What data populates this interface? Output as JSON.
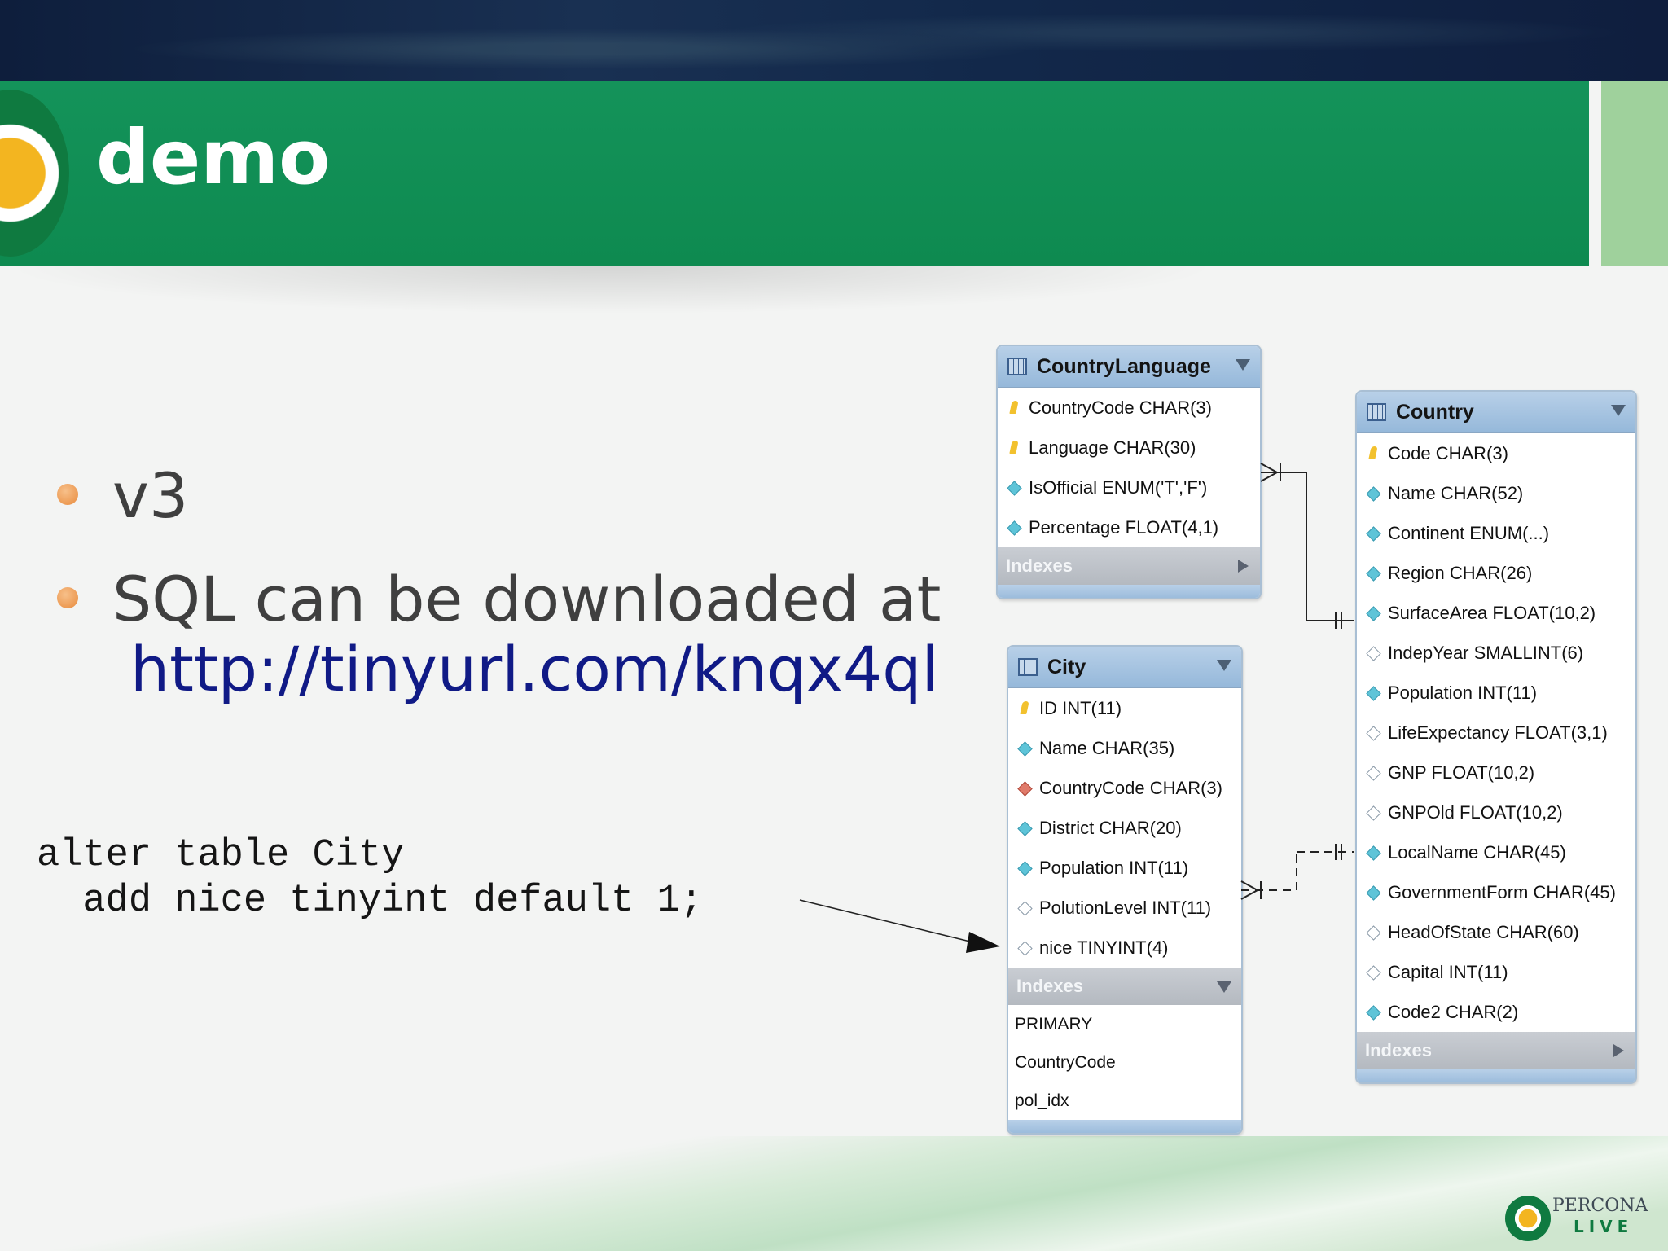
{
  "slide": {
    "title": "demo",
    "bullets": [
      "v3",
      "SQL can be downloaded at"
    ],
    "link": "http://tinyurl.com/knqx4ql",
    "code_lines": [
      "alter table City",
      "  add nice tinyint default 1;"
    ]
  },
  "brand": {
    "name": "PERCONA",
    "sub": "LIVE",
    "green": "#0e8a50",
    "accent": "#f3b520",
    "link_color": "#101a86"
  },
  "tables": {
    "countrylanguage": {
      "name": "CountryLanguage",
      "columns": [
        {
          "label": "CountryCode CHAR(3)",
          "icon": "primary-key-icon"
        },
        {
          "label": "Language CHAR(30)",
          "icon": "primary-key-icon"
        },
        {
          "label": "IsOfficial ENUM('T','F')",
          "icon": "column-icon"
        },
        {
          "label": "Percentage FLOAT(4,1)",
          "icon": "column-icon"
        }
      ],
      "indexes_label": "Indexes"
    },
    "country": {
      "name": "Country",
      "columns": [
        {
          "label": "Code CHAR(3)",
          "icon": "primary-key-icon"
        },
        {
          "label": "Name CHAR(52)",
          "icon": "column-icon"
        },
        {
          "label": "Continent ENUM(...)",
          "icon": "column-icon"
        },
        {
          "label": "Region CHAR(26)",
          "icon": "column-icon"
        },
        {
          "label": "SurfaceArea FLOAT(10,2)",
          "icon": "column-icon"
        },
        {
          "label": "IndepYear SMALLINT(6)",
          "icon": "nullable-column-icon"
        },
        {
          "label": "Population INT(11)",
          "icon": "column-icon"
        },
        {
          "label": "LifeExpectancy FLOAT(3,1)",
          "icon": "nullable-column-icon"
        },
        {
          "label": "GNP FLOAT(10,2)",
          "icon": "nullable-column-icon"
        },
        {
          "label": "GNPOld FLOAT(10,2)",
          "icon": "nullable-column-icon"
        },
        {
          "label": "LocalName CHAR(45)",
          "icon": "column-icon"
        },
        {
          "label": "GovernmentForm CHAR(45)",
          "icon": "column-icon"
        },
        {
          "label": "HeadOfState CHAR(60)",
          "icon": "nullable-column-icon"
        },
        {
          "label": "Capital INT(11)",
          "icon": "nullable-column-icon"
        },
        {
          "label": "Code2 CHAR(2)",
          "icon": "column-icon"
        }
      ],
      "indexes_label": "Indexes"
    },
    "city": {
      "name": "City",
      "columns": [
        {
          "label": "ID INT(11)",
          "icon": "primary-key-icon"
        },
        {
          "label": "Name CHAR(35)",
          "icon": "column-icon"
        },
        {
          "label": "CountryCode CHAR(3)",
          "icon": "foreign-key-icon"
        },
        {
          "label": "District CHAR(20)",
          "icon": "column-icon"
        },
        {
          "label": "Population INT(11)",
          "icon": "column-icon"
        },
        {
          "label": "PolutionLevel INT(11)",
          "icon": "nullable-column-icon"
        },
        {
          "label": "nice TINYINT(4)",
          "icon": "nullable-column-icon"
        }
      ],
      "indexes_label": "Indexes",
      "indexes": [
        "PRIMARY",
        "CountryCode",
        "pol_idx"
      ]
    }
  }
}
